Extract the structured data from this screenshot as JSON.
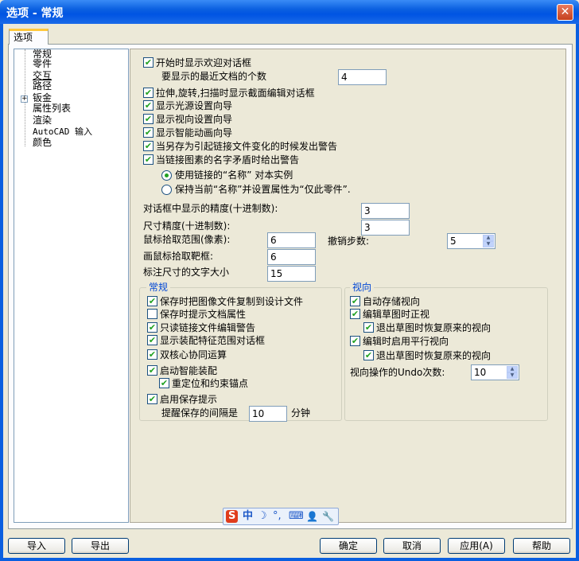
{
  "window": {
    "title": "选项 - 常规",
    "close_glyph": "✕"
  },
  "tabs": [
    {
      "label": "选项"
    }
  ],
  "tree": {
    "items": [
      {
        "label": "常规"
      },
      {
        "label": "零件"
      },
      {
        "label": "交互"
      },
      {
        "label": "路径"
      },
      {
        "label": "钣金"
      },
      {
        "label": "属性列表"
      },
      {
        "label": "渲染"
      },
      {
        "label": "AutoCAD 输入"
      },
      {
        "label": "颜色"
      }
    ],
    "expander_glyph": "+"
  },
  "options": {
    "show_welcome": {
      "label": "开始时显示欢迎对话框",
      "checked": true
    },
    "recent_docs": {
      "label": "要显示的最近文档的个数",
      "value": "4"
    },
    "show_section_dialog": {
      "label": "拉伸,旋转,扫描时显示截面编辑对话框",
      "checked": true
    },
    "light_wizard": {
      "label": "显示光源设置向导",
      "checked": true
    },
    "view_wizard": {
      "label": "显示视向设置向导",
      "checked": true
    },
    "anim_wizard": {
      "label": "显示智能动画向导",
      "checked": true
    },
    "save_as_warn": {
      "label": "当另存为引起链接文件变化的时候发出警告",
      "checked": true
    },
    "name_conflict_warn": {
      "label": "当链接图素的名字矛盾时给出警告",
      "checked": true
    },
    "radio_use_link": {
      "label": "使用链接的“名称” 对本实例",
      "selected": true
    },
    "radio_keep_name": {
      "label": "保持当前“名称”并设置属性为“仅此零件”.",
      "selected": false
    }
  },
  "precision": {
    "dialog_precision": {
      "label": "对话框中显示的精度(十进制数):",
      "value": "3"
    },
    "dimension_precision": {
      "label": "尺寸精度(十进制数):",
      "value": "3"
    },
    "mouse_pick": {
      "label": "鼠标拾取范围(像素):",
      "value": "6"
    },
    "undo_steps": {
      "label": "撤销步数:",
      "value": "5"
    },
    "pick_box": {
      "label": "画鼠标拾取靶框:",
      "value": "6"
    },
    "dim_text_size": {
      "label": "标注尺寸的文字大小",
      "value": "15"
    }
  },
  "general_group": {
    "title": "常规",
    "copy_image": {
      "label": "保存时把图像文件复制到设计文件",
      "checked": true
    },
    "prompt_props": {
      "label": "保存时提示文档属性",
      "checked": false
    },
    "readonly_warn": {
      "label": "只读链接文件编辑警告",
      "checked": true
    },
    "assembly_dialog": {
      "label": "显示装配特征范围对话框",
      "checked": true
    },
    "dual_core": {
      "label": "双核心协同运算",
      "checked": true
    },
    "smart_assembly": {
      "label": "启动智能装配",
      "checked": true
    },
    "reposition": {
      "label": "重定位和约束锚点",
      "checked": true
    },
    "save_reminder": {
      "label": "启用保存提示",
      "checked": true
    },
    "reminder_interval": {
      "label": "提醒保存的间隔是",
      "value": "10",
      "unit": "分钟"
    }
  },
  "view_group": {
    "title": "视向",
    "auto_save_view": {
      "label": "自动存储视向",
      "checked": true
    },
    "sketch_normal": {
      "label": "编辑草图时正视",
      "checked": true
    },
    "restore_on_exit1": {
      "label": "退出草图时恢复原来的视向",
      "checked": true
    },
    "parallel_view": {
      "label": "编辑时启用平行视向",
      "checked": true
    },
    "restore_on_exit2": {
      "label": "退出草图时恢复原来的视向",
      "checked": true
    },
    "undo_count": {
      "label": "视向操作的Undo次数:",
      "value": "10"
    }
  },
  "ime_toolbar": {
    "items": [
      "S",
      "中",
      "☽",
      "°,",
      "⌨",
      "👤",
      "🔧"
    ]
  },
  "buttons": {
    "import": "导入",
    "export": "导出",
    "ok": "确定",
    "cancel": "取消",
    "apply": "应用(A)",
    "help": "帮助"
  },
  "colors": {
    "title_bar": "#0054e3",
    "accent": "#ffc83c",
    "check": "#21a121"
  }
}
